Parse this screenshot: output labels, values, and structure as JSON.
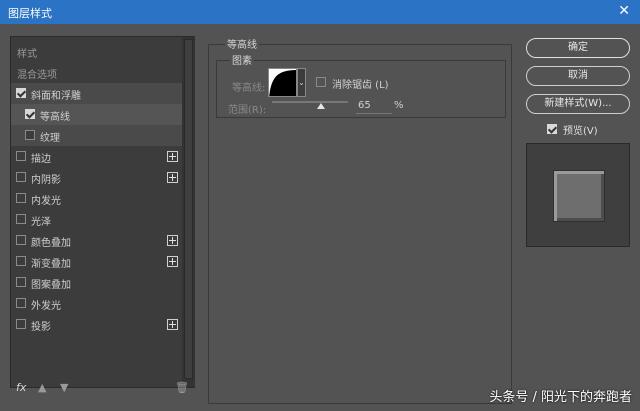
{
  "window": {
    "title": "图层样式",
    "close_glyph": "✕"
  },
  "sidebar": {
    "items": [
      {
        "label": "样式",
        "type": "header"
      },
      {
        "label": "混合选项",
        "type": "header"
      },
      {
        "label": "斜面和浮雕",
        "checked": true,
        "plus": false
      },
      {
        "label": "等高线",
        "checked": true,
        "plus": false
      },
      {
        "label": "纹理",
        "checked": false,
        "plus": false
      },
      {
        "label": "描边",
        "checked": false,
        "plus": true
      },
      {
        "label": "内阴影",
        "checked": false,
        "plus": true
      },
      {
        "label": "内发光",
        "checked": false,
        "plus": false
      },
      {
        "label": "光泽",
        "checked": false,
        "plus": false
      },
      {
        "label": "颜色叠加",
        "checked": false,
        "plus": true
      },
      {
        "label": "渐变叠加",
        "checked": false,
        "plus": true
      },
      {
        "label": "图案叠加",
        "checked": false,
        "plus": false
      },
      {
        "label": "外发光",
        "checked": false,
        "plus": false
      },
      {
        "label": "投影",
        "checked": false,
        "plus": true
      }
    ],
    "tools": {
      "fx": "fx",
      "up": "▲",
      "down": "▼",
      "trash": "🗑"
    }
  },
  "panel": {
    "group_title": "等高线",
    "sub_title": "图素",
    "contour_label": "等高线:",
    "dropdown_glyph": "⌄",
    "antialias_label": "消除锯齿 (L)",
    "range_label": "范围(R):",
    "range_value": "65",
    "range_unit": "%",
    "range_level": 0.65
  },
  "buttons": {
    "ok": "确定",
    "cancel": "取消",
    "new_style": "新建样式(W)...",
    "preview_label": "预览(V)"
  },
  "watermark": "头条号 / 阳光下的奔跑者"
}
